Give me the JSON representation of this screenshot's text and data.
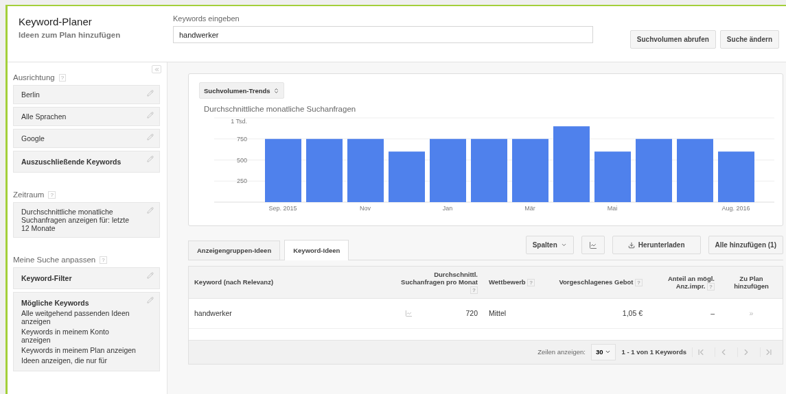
{
  "header": {
    "title": "Keyword-Planer",
    "subtitle": "Ideen zum Plan hinzufügen",
    "keyword_label": "Keywords eingeben",
    "keyword_value": "handwerker",
    "buttons": [
      "Suchvolumen abrufen",
      "Suche ändern"
    ]
  },
  "sidebar": {
    "sections": [
      {
        "title": "Ausrichtung",
        "help": "?",
        "items": [
          {
            "kind": "plain",
            "label": "Berlin"
          },
          {
            "kind": "plain",
            "label": "Alle Sprachen"
          },
          {
            "kind": "plain",
            "label": "Google"
          },
          {
            "kind": "bold",
            "label": "Auszuschließende Keywords"
          }
        ]
      },
      {
        "title": "Zeitraum",
        "help": "?",
        "items": [
          {
            "kind": "plain",
            "label": "Durchschnittliche monatliche Suchanfragen anzeigen für: letzte 12 Monate"
          }
        ]
      },
      {
        "title": "Meine Suche anpassen",
        "help": "?",
        "items": [
          {
            "kind": "bold",
            "label": "Keyword-Filter"
          },
          {
            "kind": "detail",
            "label": "Mögliche Keywords",
            "lines": [
              "Alle weitgehend passenden Ideen anzeigen",
              "Keywords in meinem Konto anzeigen",
              "Keywords in meinem Plan anzeigen",
              "Ideen anzeigen, die nur für"
            ]
          }
        ]
      }
    ]
  },
  "chart": {
    "selector": "Suchvolumen-Trends",
    "top_tick_label": "1 Tsd.",
    "chart_data": {
      "type": "bar",
      "grid": true,
      "categories": [
        "Sep. 2015",
        null,
        "Nov",
        null,
        "Jan",
        null,
        "Mär",
        null,
        "Mai",
        null,
        null,
        "Aug. 2016"
      ],
      "yticks": [
        250,
        500,
        750
      ],
      "ylim": [
        0,
        1000
      ],
      "series": [
        {
          "name": "Durchschnittliche monatliche Suchanfragen",
          "color": "#4f81ec",
          "values": [
            750,
            750,
            750,
            600,
            750,
            750,
            750,
            900,
            600,
            750,
            750,
            600
          ]
        }
      ]
    }
  },
  "tabs": [
    {
      "label": "Anzeigengruppen-Ideen",
      "selected": false
    },
    {
      "label": "Keyword-Ideen",
      "selected": true
    }
  ],
  "toolbar": {
    "columns": "Spalten",
    "download": "Herunterladen",
    "add_all": "Alle hinzufügen (1)"
  },
  "table": {
    "columns": [
      {
        "label": "Keyword (nach Relevanz)"
      },
      {
        "label": "Durchschnittl. Suchanfragen pro Monat",
        "help": "?"
      },
      {
        "label": "Wettbewerb",
        "help": "?"
      },
      {
        "label": "Vorgeschlagenes Gebot",
        "help": "?"
      },
      {
        "label": "Anteil an mögl. Anz.impr.",
        "help": "?"
      },
      {
        "label": "Zu Plan hinzufügen"
      }
    ],
    "rows": [
      {
        "keyword": "handwerker",
        "searches": "720",
        "competition": "Mittel",
        "bid": "1,05 €",
        "share": "–",
        "add": "»"
      }
    ]
  },
  "pagination": {
    "rows_label": "Zeilen anzeigen:",
    "rows_value": "30",
    "range": "1 - 1 von 1 Keywords"
  }
}
